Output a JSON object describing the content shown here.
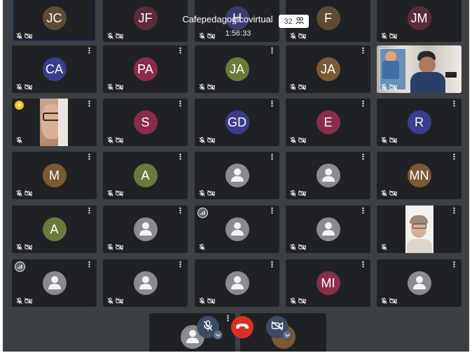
{
  "meeting": {
    "title": "Cafepedagogicovirtual",
    "elapsed": "1:56:33",
    "participant_count": "32"
  },
  "colors": {
    "background": "#3c4043",
    "tile": "#202124",
    "end_call": "#d93025",
    "control_dark": "#3c4a63"
  },
  "tiles": [
    {
      "initials": "JC",
      "color": "#5e4b35"
    },
    {
      "initials": "JF",
      "color": "#5a2c3a"
    },
    {
      "initials": "H",
      "color": "#3a3c6e"
    },
    {
      "initials": "F",
      "color": "#5e4b35"
    },
    {
      "initials": "JM",
      "color": "#5a2c3a"
    },
    {
      "initials": "CA",
      "color": "#3a3c8e"
    },
    {
      "initials": "PA",
      "color": "#8a2d4a"
    },
    {
      "initials": "JA",
      "color": "#6b7a3a"
    },
    {
      "initials": "JA",
      "color": "#7a5a35"
    },
    {
      "initials": "",
      "video": "photo"
    },
    {
      "initials": "",
      "video": "face-left"
    },
    {
      "initials": "S",
      "color": "#8a2d4a"
    },
    {
      "initials": "GD",
      "color": "#3a3c8e"
    },
    {
      "initials": "E",
      "color": "#8a2d4a"
    },
    {
      "initials": "R",
      "color": "#3a3c8e"
    },
    {
      "initials": "M",
      "color": "#7a5a35"
    },
    {
      "initials": "A",
      "color": "#6b7a3a"
    },
    {
      "initials": "",
      "generic": true
    },
    {
      "initials": "",
      "generic": true
    },
    {
      "initials": "MN",
      "color": "#7a5a35"
    },
    {
      "initials": "A",
      "color": "#6b7a3a"
    },
    {
      "initials": "",
      "generic": true
    },
    {
      "initials": "",
      "generic": true,
      "speaking": true
    },
    {
      "initials": "",
      "generic": true
    },
    {
      "initials": "",
      "video": "face-right"
    },
    {
      "initials": "",
      "generic": true,
      "speaking": true
    },
    {
      "initials": "",
      "generic": true
    },
    {
      "initials": "",
      "generic": true
    },
    {
      "initials": "MI",
      "color": "#8a2d4a"
    },
    {
      "initials": "",
      "generic": true
    }
  ],
  "controls": {
    "mic": "mic-off-icon",
    "end_call": "call-end-icon",
    "camera": "camera-off-icon"
  }
}
